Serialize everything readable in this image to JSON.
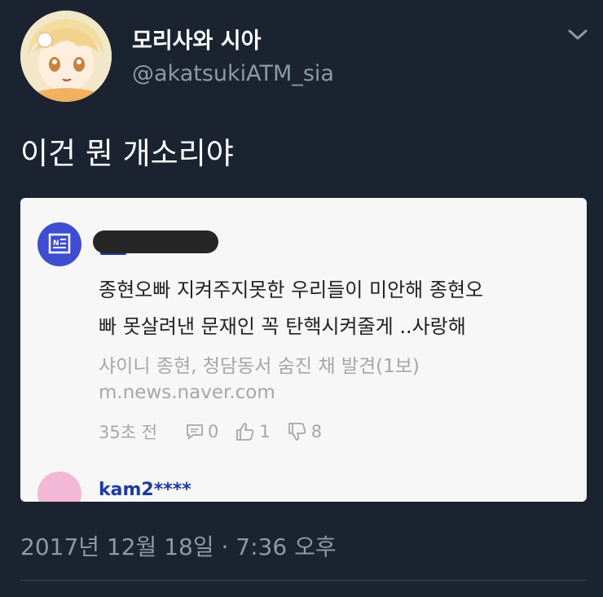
{
  "tweet": {
    "display_name": "모리사와 시아",
    "handle": "@akatsukiATM_sia",
    "text": "이건 뭔 개소리야",
    "timestamp": "2017년 12월 18일 · 7:36 오후"
  },
  "card": {
    "comment_line1": "종현오빠 지켜주지못한 우리들이 미안해 종현오",
    "comment_line2": "빠 못살려낸 문재인 꼭 탄핵시켜줄게 ..사랑해",
    "headline": "샤이니 종현, 청담동서 숨진 채 발견(1보)",
    "url": "m.news.naver.com",
    "time_ago": "35초 전",
    "reply_count": "0",
    "like_count": "1",
    "dislike_count": "8",
    "next_user": "kam2****"
  },
  "colors": {
    "background": "#1b2330",
    "secondary_text": "#8d99a6",
    "card_bg": "#f7f7f7",
    "news_icon_bg": "#3f4ed0"
  },
  "icons": [
    "chevron-down-icon",
    "news-icon",
    "comment-icon",
    "thumbs-up-icon",
    "thumbs-down-icon"
  ]
}
